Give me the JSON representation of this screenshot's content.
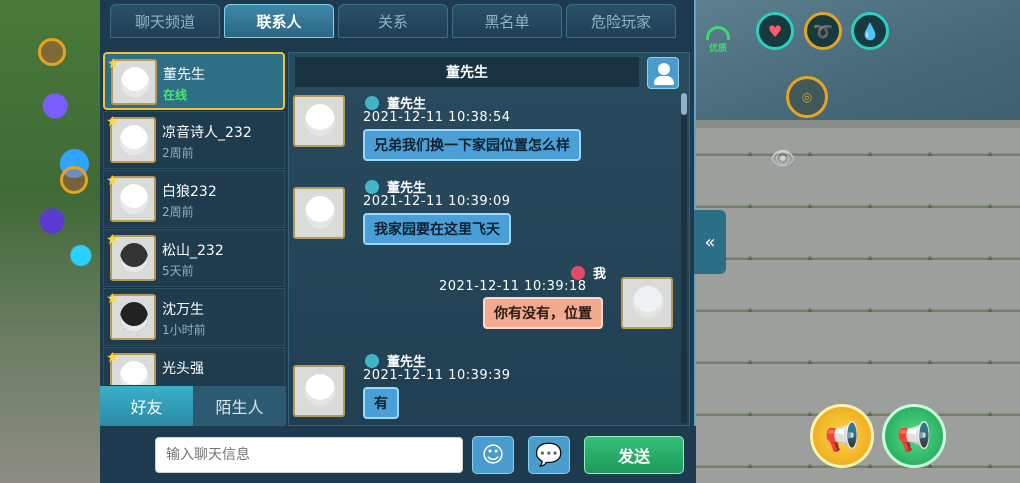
{
  "tabs": [
    {
      "label": "聊天频道",
      "active": false
    },
    {
      "label": "联系人",
      "active": true
    },
    {
      "label": "关系",
      "active": false
    },
    {
      "label": "黑名单",
      "active": false
    },
    {
      "label": "危险玩家",
      "active": false
    }
  ],
  "contacts": [
    {
      "name": "董先生",
      "status": "在线",
      "online": true,
      "selected": true
    },
    {
      "name": "凉音诗人_232",
      "status": "2周前",
      "online": false
    },
    {
      "name": "白狼232",
      "status": "2周前",
      "online": false
    },
    {
      "name": "松山_232",
      "status": "5天前",
      "online": false
    },
    {
      "name": "沈万生",
      "status": "1小时前",
      "online": false
    },
    {
      "name": "光头强",
      "status": "",
      "online": false
    }
  ],
  "bottom_tabs": {
    "friends": "好友",
    "strangers": "陌生人"
  },
  "chat": {
    "header_title": "董先生",
    "messages": [
      {
        "sender": "董先生",
        "time": "2021-12-11   10:38:54",
        "text": "兄弟我们换一下家园位置怎么样",
        "mine": false
      },
      {
        "sender": "董先生",
        "time": "2021-12-11   10:39:09",
        "text": "我家园要在这里飞天",
        "mine": false
      },
      {
        "sender": "我",
        "time": "2021-12-11   10:39:18",
        "text": "你有没有，位置",
        "mine": true
      },
      {
        "sender": "董先生",
        "time": "2021-12-11   10:39:39",
        "text": "有",
        "mine": false
      }
    ]
  },
  "input": {
    "placeholder": "输入聊天信息",
    "send_label": "发送",
    "emoji_glyph": "☺",
    "bubble_glyph": "💬"
  },
  "hud": {
    "signal_label": "优质",
    "collapse_glyph": "«",
    "eye_glyph": "👁",
    "heart_glyph": "♥",
    "drop_glyph": "💧",
    "horn_glyph": "📢"
  },
  "colors": {
    "accent": "#3bb0c9",
    "online": "#4be86a",
    "send": "#1d9a5a",
    "selected_border": "#f0c23a"
  }
}
